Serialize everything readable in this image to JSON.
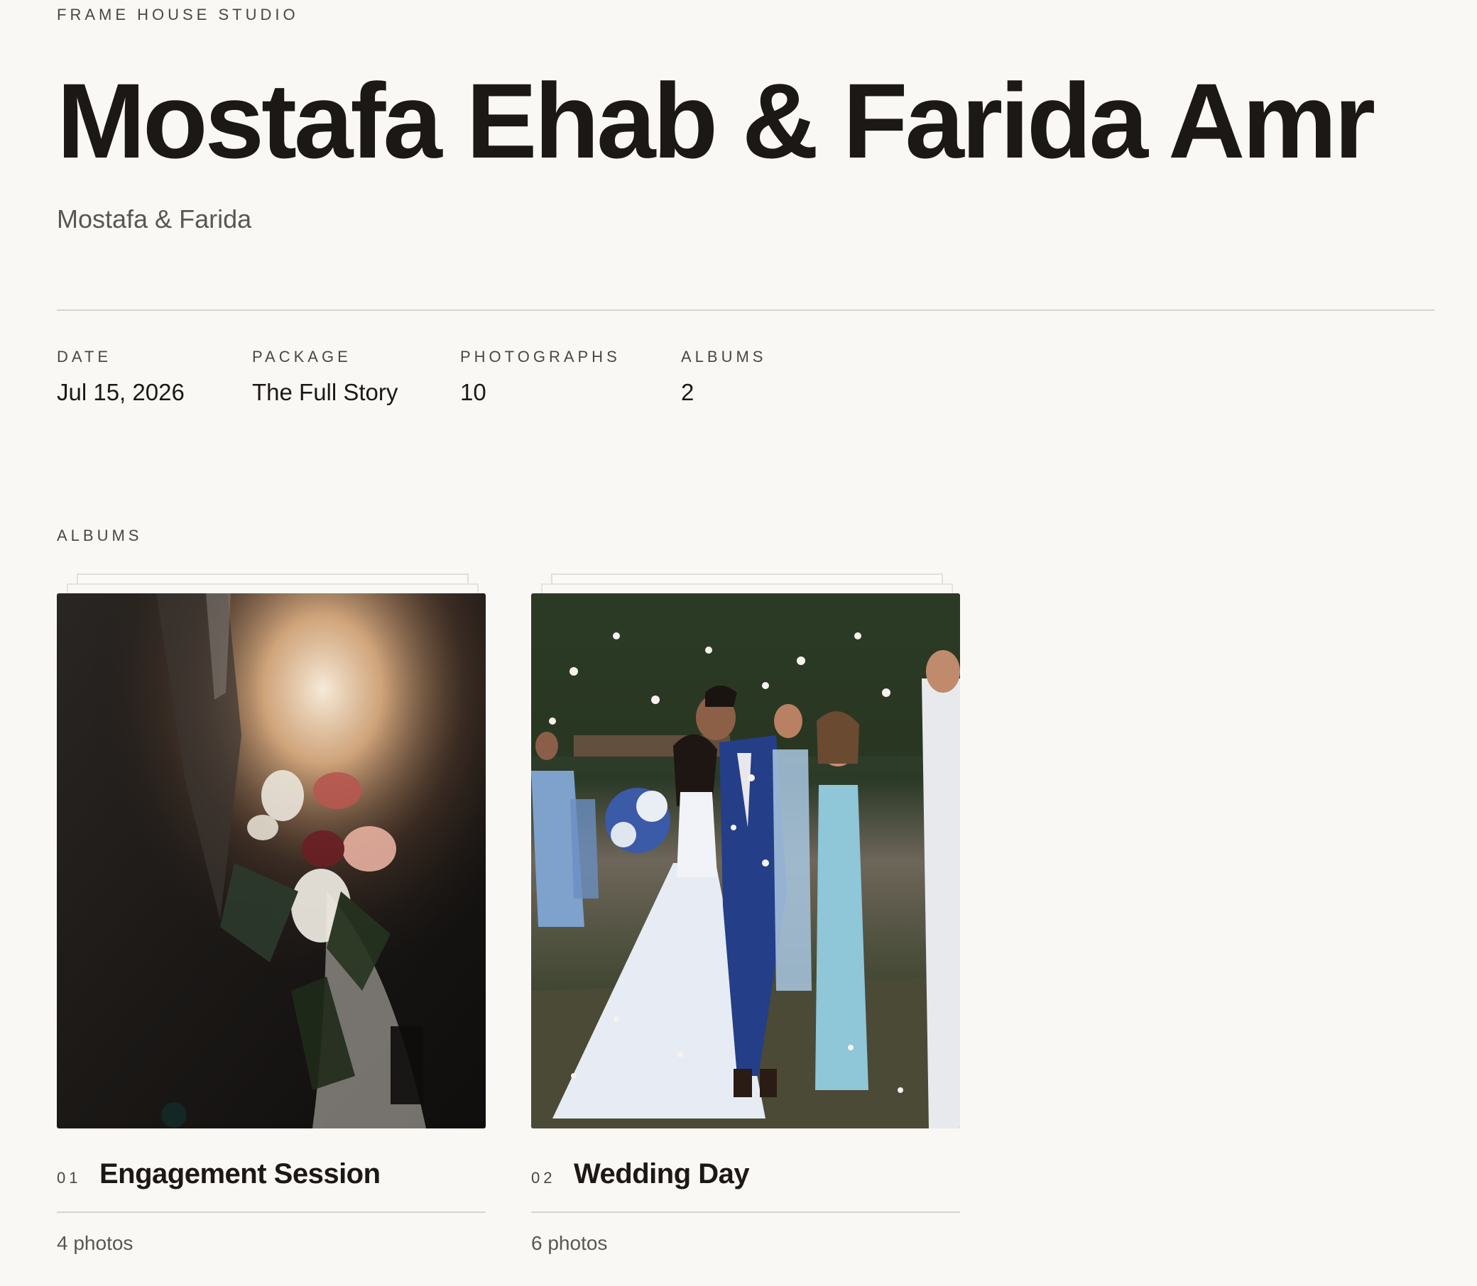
{
  "studio": {
    "name": "FRAME HOUSE STUDIO"
  },
  "header": {
    "title": "Mostafa Ehab & Farida Amr",
    "subtitle": "Mostafa & Farida"
  },
  "meta": {
    "date": {
      "label": "DATE",
      "value": "Jul 15, 2026"
    },
    "package": {
      "label": "PACKAGE",
      "value": "The Full Story"
    },
    "photographs": {
      "label": "PHOTOGRAPHS",
      "value": "10"
    },
    "albums": {
      "label": "ALBUMS",
      "value": "2"
    }
  },
  "albums_section": {
    "label": "ALBUMS",
    "items": [
      {
        "number": "01",
        "name": "Engagement Session",
        "count": "4 photos",
        "cover_icon": "bouquet-photo"
      },
      {
        "number": "02",
        "name": "Wedding Day",
        "count": "6 photos",
        "cover_icon": "couple-kiss-photo"
      }
    ]
  },
  "colors": {
    "background": "#faf8f5",
    "text": "#1c1816",
    "muted": "#5a5654",
    "rule": "#d8d4d0"
  }
}
